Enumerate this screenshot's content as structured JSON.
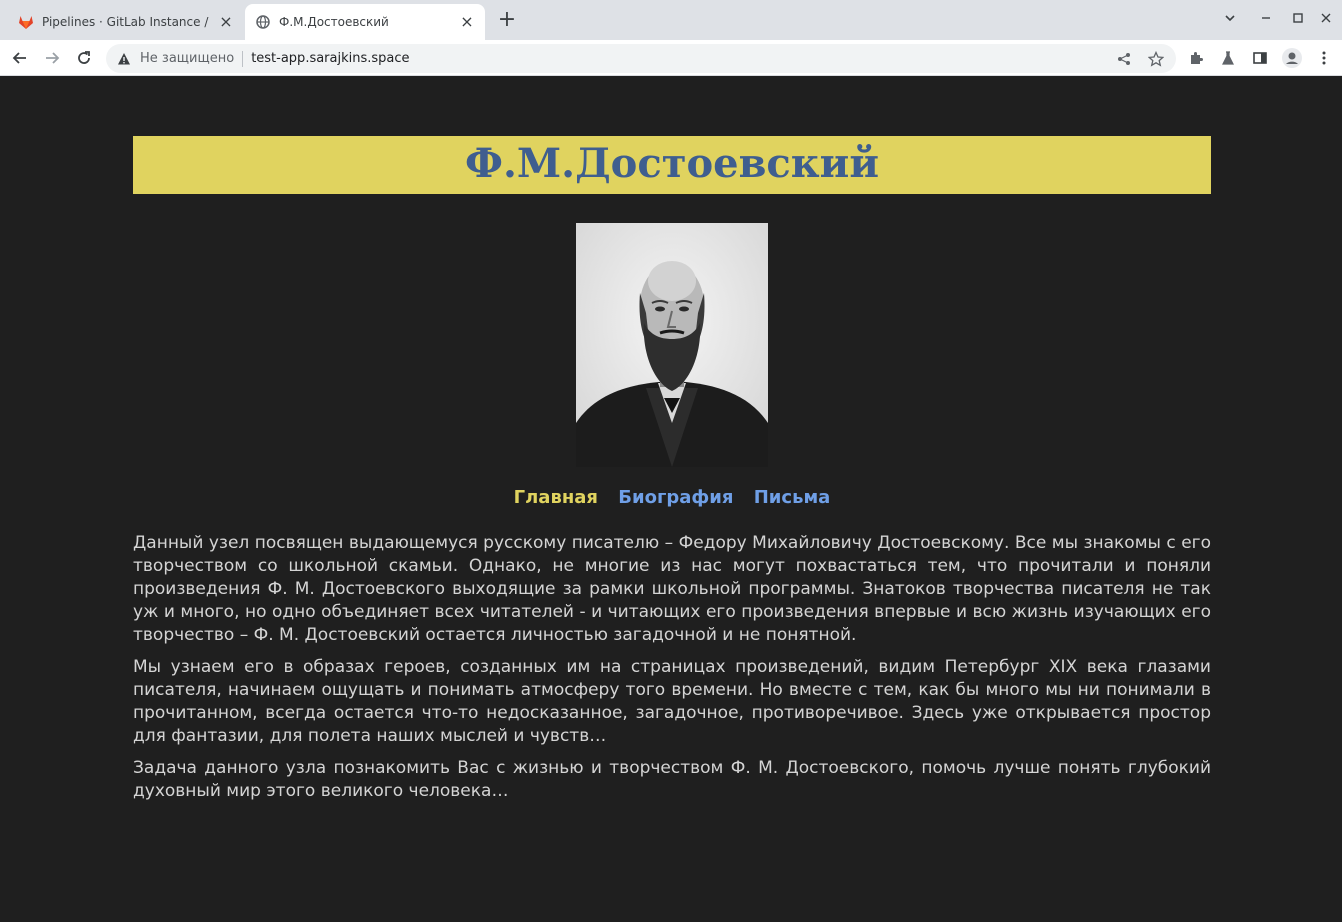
{
  "browser": {
    "tabs": [
      {
        "title": "Pipelines · GitLab Instance / myap",
        "icon": "gitlab-icon",
        "active": false
      },
      {
        "title": "Ф.М.Достоевский",
        "icon": "globe-icon",
        "active": true
      }
    ],
    "address": {
      "security_label": "Не защищено",
      "url": "test-app.sarajkins.space"
    }
  },
  "page": {
    "heading": "Ф.М.Достоевский",
    "nav": {
      "home": "Главная",
      "biography": "Биография",
      "letters": "Письма"
    },
    "paragraphs": [
      "Данный узел посвящен выдающемуся русскому писателю – Федору Михайловичу Достоевскому. Все мы знакомы с его творчеством со школьной скамьи. Однако, не многие из нас могут похвастаться тем, что прочитали и поняли произведения Ф. М. Достоевского выходящие за рамки школьной программы. Знатоков творчества писателя не так уж и много, но одно объединяет всех читателей - и читающих его произведения впервые и всю жизнь изучающих его творчество – Ф. М. Достоевский остается личностью загадочной и не понятной.",
      "Мы узнаем его в образах героев, созданных им на страницах произведений, видим Петербург XIX века глазами писателя, начинаем ощущать и понимать атмосферу того времени. Но вместе с тем, как бы много мы ни понимали в прочитанном, всегда остается что-то недосказанное, загадочное, противоречивое. Здесь уже открывается простор для фантазии, для полета наших мыслей и чувств…",
      "Задача данного узла познакомить Вас с жизнью и творчеством Ф. М. Достоевского, помочь лучше понять глубокий духовный мир этого великого человека…"
    ]
  },
  "colors": {
    "page_bg": "#1f1f1f",
    "banner_bg": "#e0d35f",
    "heading": "#3f5e8f",
    "nav_current": "#e0d35f",
    "nav_link": "#6f9fe6",
    "body_text": "#d4d4d4"
  }
}
